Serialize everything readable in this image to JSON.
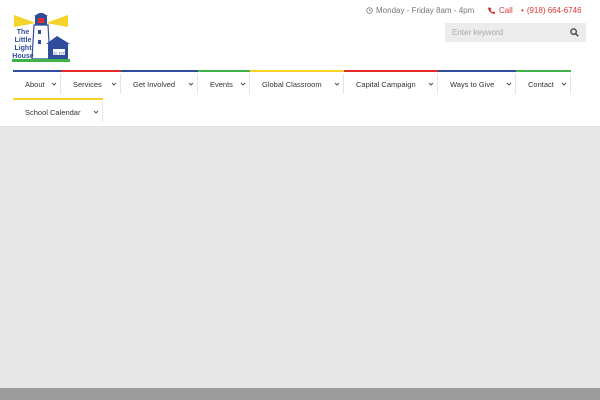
{
  "colors": {
    "accent_red": "#d9383a",
    "nav_blue": "#2f4d9b",
    "nav_green": "#3db34a",
    "nav_yellow": "#f5d329",
    "nav_red": "#e32b2b"
  },
  "logo": {
    "lines": [
      "The",
      "Little",
      "Light",
      "House"
    ],
    "est": "Est. 1972"
  },
  "top_info": {
    "hours": "Monday - Friday 8am - 4pm",
    "call_label": "Call",
    "phone": "(918) 664-6746",
    "phone_bullet": "•"
  },
  "search": {
    "placeholder": "Enter keyword",
    "value": ""
  },
  "nav": {
    "items": [
      {
        "label": "About",
        "bar_color": "#2f4d9b"
      },
      {
        "label": "Services",
        "bar_color": "#e32b2b"
      },
      {
        "label": "Get Involved",
        "bar_color": "#2f4d9b"
      },
      {
        "label": "Events",
        "bar_color": "#3db34a"
      },
      {
        "label": "Global Classroom",
        "bar_color": "#f5d329"
      },
      {
        "label": "Capital Campaign",
        "bar_color": "#e32b2b"
      },
      {
        "label": "Ways to Give",
        "bar_color": "#2f4d9b"
      },
      {
        "label": "Contact",
        "bar_color": "#3db34a"
      },
      {
        "label": "School Calendar",
        "bar_color": "#f5d329"
      }
    ]
  }
}
